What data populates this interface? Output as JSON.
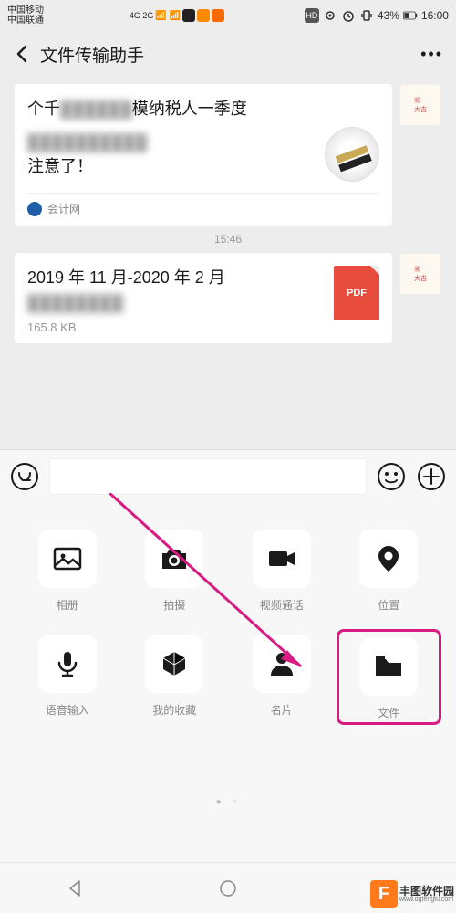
{
  "status": {
    "carrier1": "中国移动",
    "carrier2": "中国联通",
    "net": "4G 2G",
    "hd": "HD",
    "battery_pct": "43%",
    "time": "16:00"
  },
  "header": {
    "title": "文件传输助手"
  },
  "messages": {
    "card1": {
      "line1_part1": "个千",
      "line1_blur": "▓▓▓▓▓▓",
      "line1_part2": "模纳税人一季度",
      "line2_blur": "▓▓▓▓▓▓▓▓▓▓",
      "line3": "注意了！",
      "source": "会计网"
    },
    "time1": "15:46",
    "card2": {
      "title": "2019 年 11 月-2020 年 2 月",
      "title_blur": "▓▓▓▓▓▓▓▓",
      "size": "165.8 KB",
      "badge": "PDF"
    }
  },
  "attachments": {
    "row1": [
      "相册",
      "拍摄",
      "视频通话",
      "位置"
    ],
    "row2": [
      "语音输入",
      "我的收藏",
      "名片",
      "文件"
    ]
  },
  "watermark": {
    "icon_letter": "F",
    "name": "丰图软件园",
    "url": "www.dgfengtu.com"
  }
}
